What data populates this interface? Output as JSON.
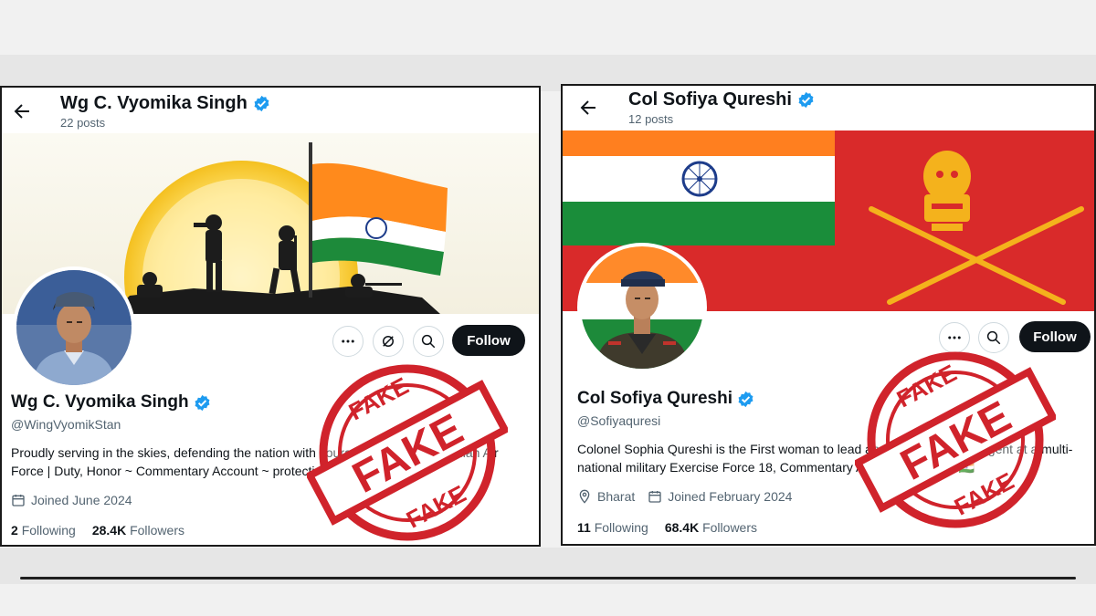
{
  "colors": {
    "stamp_red": "#d0232b",
    "verified_blue": "#1d9bf0",
    "follow_bg": "#0f1419"
  },
  "stamp": {
    "top_text": "FAKE",
    "center_text": "FAKE",
    "bottom_text": "FAKE"
  },
  "profiles": [
    {
      "header_name": "Wg C. Vyomika Singh",
      "posts": "22 posts",
      "name": "Wg C. Vyomika Singh",
      "handle": "@WingVyomikStan",
      "bio": "Proudly serving in the skies, defending the nation with courage and integrity. Indian Air Force | Duty, Honor ~ Commentary Account ~ protecting the motherland",
      "joined": "Joined June 2024",
      "following_count": "2",
      "following_label": "Following",
      "followers_count": "28.4K",
      "followers_label": "Followers",
      "follow_label": "Follow"
    },
    {
      "header_name": "Col Sofiya Qureshi",
      "posts": "12 posts",
      "name": "Col Sofiya Qureshi",
      "handle": "@Sofiyaquresi",
      "bio": "Colonel Sophia Qureshi is the First woman to lead an Indian Army contingent at a multi-national military Exercise Force 18, Commentary Account, Jai Hind 🇮🇳",
      "location": "Bharat",
      "joined": "Joined February 2024",
      "following_count": "11",
      "following_label": "Following",
      "followers_count": "68.4K",
      "followers_label": "Followers",
      "follow_label": "Follow"
    }
  ]
}
